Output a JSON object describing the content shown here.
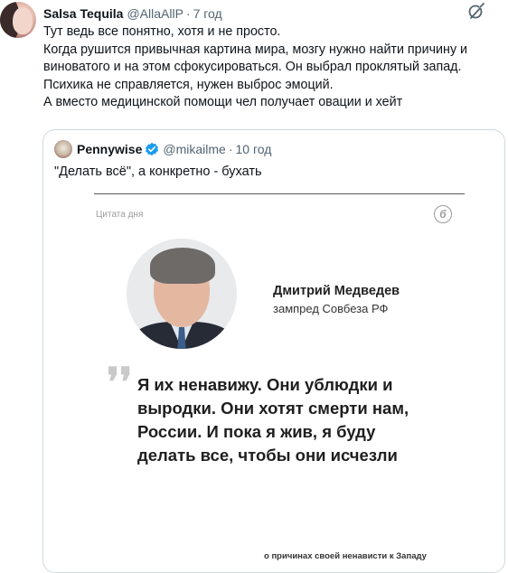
{
  "tweet": {
    "author_name": "Salsa Tequila",
    "author_handle": "@AllaAllP",
    "separator": "·",
    "time": "7 год",
    "lines": [
      "Тут ведь все понятно, хотя и не просто.",
      "Когда рушится привычная картина мира, мозгу нужно найти причину и",
      "виноватого и на этом сфокусироваться. Он выбрал проклятый запад.",
      "Психика не справляется, нужен выброс эмоций.",
      "А вместо медицинской помощи чел получает овации и хейт"
    ],
    "more_icon": "grok-slash-icon"
  },
  "quoted": {
    "author_name": "Pennywise",
    "verified": true,
    "author_handle": "@mikailme",
    "separator": "·",
    "time": "10 год",
    "text": "\"Делать всё\", а конкретно - бухать",
    "card": {
      "label": "Цитата дня",
      "brand_glyph": "б",
      "person_name": "Дмитрий Медведев",
      "person_title": "зампред Совбеза РФ",
      "quote_mark": "❜❜",
      "quote_lines": [
        "Я их ненавижу. Они ублюдки и",
        "выродки. Они хотят смерти нам,",
        "России. И пока я жив, я буду",
        "делать все, чтобы они исчезли"
      ],
      "footnote": "о причинах своей ненависти к Западу"
    }
  },
  "colors": {
    "text": "#0f1419",
    "muted": "#536471",
    "border": "#cfd9de",
    "verified_blue": "#1d9bf0"
  }
}
